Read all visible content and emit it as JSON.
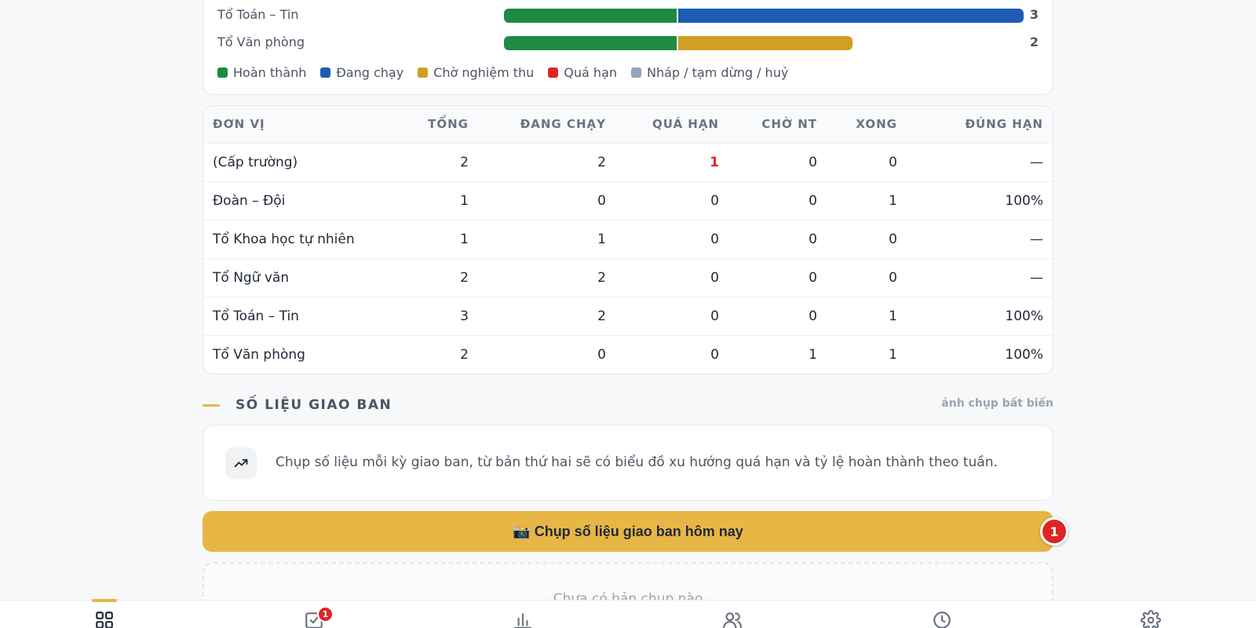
{
  "bars": [
    {
      "label": "Tổ Toán – Tin",
      "count": "3",
      "segments": [
        {
          "status": "done",
          "fraction": 0.333
        },
        {
          "status": "running",
          "fraction": 0.667
        }
      ]
    },
    {
      "label": "Tổ Văn phòng",
      "count": "2",
      "segments": [
        {
          "status": "done",
          "fraction": 0.333
        },
        {
          "status": "pending",
          "fraction": 0.333
        }
      ]
    }
  ],
  "legend": [
    {
      "label": "Hoàn thành",
      "color": "#1e8a44"
    },
    {
      "label": "Đang chạy",
      "color": "#1f5bb5"
    },
    {
      "label": "Chờ nghiệm thu",
      "color": "#d29f22"
    },
    {
      "label": "Quá hạn",
      "color": "#dc2626"
    },
    {
      "label": "Nháp / tạm dừng / huỷ",
      "color": "#94a3b8"
    }
  ],
  "table": {
    "headers": [
      "ĐƠN VỊ",
      "TỔNG",
      "ĐANG CHẠY",
      "QUÁ HẠN",
      "CHỜ NT",
      "XONG",
      "ĐÚNG HẠN"
    ],
    "rows": [
      [
        "(Cấp trường)",
        "2",
        "2",
        "1",
        "0",
        "0",
        "—"
      ],
      [
        "Đoàn – Đội",
        "1",
        "0",
        "0",
        "0",
        "1",
        "100%"
      ],
      [
        "Tổ Khoa học tự nhiên",
        "1",
        "1",
        "0",
        "0",
        "0",
        "—"
      ],
      [
        "Tổ Ngữ văn",
        "2",
        "2",
        "0",
        "0",
        "0",
        "—"
      ],
      [
        "Tổ Toán – Tin",
        "3",
        "2",
        "0",
        "0",
        "1",
        "100%"
      ],
      [
        "Tổ Văn phòng",
        "2",
        "0",
        "0",
        "1",
        "1",
        "100%"
      ]
    ]
  },
  "section": {
    "title": "SỐ LIỆU GIAO BAN",
    "note": "ảnh chụp bất biến"
  },
  "info": {
    "text": "Chụp số liệu mỗi kỳ giao ban, từ bản thứ hai sẽ có biểu đồ xu hướng quá hạn và tỷ lệ hoàn thành theo tuần.",
    "icon": "trending-up-icon"
  },
  "cta": {
    "label": "📸 Chụp số liệu giao ban hôm nay",
    "badge": "1"
  },
  "empty": {
    "text": "Chưa có bản chụp nào"
  },
  "nav": {
    "items": [
      {
        "icon": "dashboard-icon"
      },
      {
        "icon": "tasks-icon",
        "badge": "1"
      },
      {
        "icon": "chart-icon"
      },
      {
        "icon": "users-icon"
      },
      {
        "icon": "history-icon"
      },
      {
        "icon": "settings-icon"
      }
    ]
  }
}
